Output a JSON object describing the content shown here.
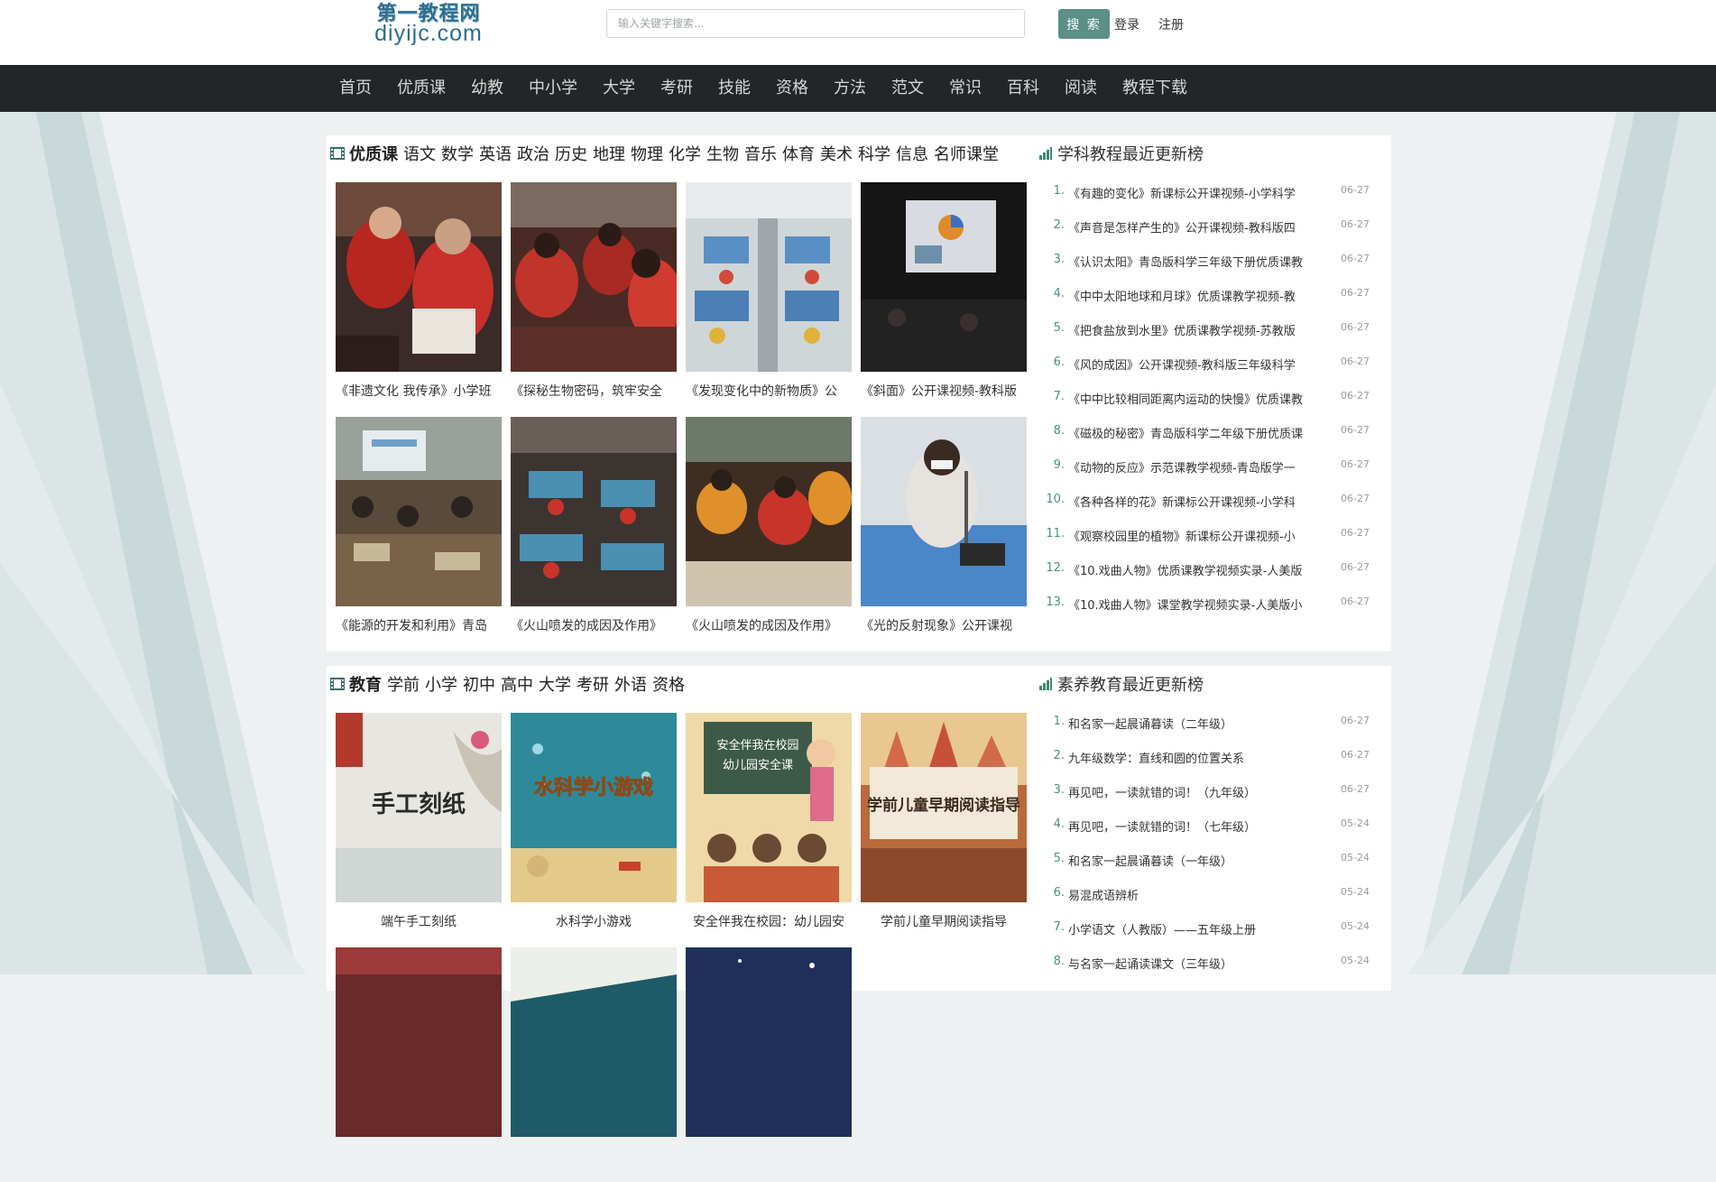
{
  "header": {
    "logo_cn": "第一教程网",
    "logo_en": "diyijc.com",
    "search_placeholder": "输入关键字搜索...",
    "search_button": "搜 索",
    "login": "登录",
    "register": "注册"
  },
  "nav": [
    "首页",
    "优质课",
    "幼教",
    "中小学",
    "大学",
    "考研",
    "技能",
    "资格",
    "方法",
    "范文",
    "常识",
    "百科",
    "阅读",
    "教程下载"
  ],
  "section1": {
    "title": "优质课",
    "tags": [
      "语文",
      "数学",
      "英语",
      "政治",
      "历史",
      "地理",
      "物理",
      "化学",
      "生物",
      "音乐",
      "体育",
      "美术",
      "科学",
      "信息",
      "名师课堂"
    ],
    "cards": [
      {
        "caption": "《非遗文化 我传承》小学班"
      },
      {
        "caption": "《探秘生物密码，筑牢安全"
      },
      {
        "caption": "《发现变化中的新物质》公"
      },
      {
        "caption": "《斜面》公开课视频-教科版"
      },
      {
        "caption": "《能源的开发和利用》青岛"
      },
      {
        "caption": "《火山喷发的成因及作用》"
      },
      {
        "caption": "《火山喷发的成因及作用》"
      },
      {
        "caption": "《光的反射现象》公开课视"
      }
    ],
    "rank_title": "学科教程最近更新榜",
    "rank": [
      {
        "num": "1.",
        "title": "《有趣的变化》新课标公开课视频-小学科学",
        "date": "06-27"
      },
      {
        "num": "2.",
        "title": "《声音是怎样产生的》公开课视频-教科版四",
        "date": "06-27"
      },
      {
        "num": "3.",
        "title": "《认识太阳》青岛版科学三年级下册优质课教",
        "date": "06-27"
      },
      {
        "num": "4.",
        "title": "《中中太阳地球和月球》优质课教学视频-教",
        "date": "06-27"
      },
      {
        "num": "5.",
        "title": "《把食盐放到水里》优质课教学视频-苏教版",
        "date": "06-27"
      },
      {
        "num": "6.",
        "title": "《风的成因》公开课视频-教科版三年级科学",
        "date": "06-27"
      },
      {
        "num": "7.",
        "title": "《中中比较相同距离内运动的快慢》优质课教",
        "date": "06-27"
      },
      {
        "num": "8.",
        "title": "《磁极的秘密》青岛版科学二年级下册优质课",
        "date": "06-27"
      },
      {
        "num": "9.",
        "title": "《动物的反应》示范课教学视频-青岛版学一",
        "date": "06-27"
      },
      {
        "num": "10.",
        "title": "《各种各样的花》新课标公开课视频-小学科",
        "date": "06-27"
      },
      {
        "num": "11.",
        "title": "《观察校园里的植物》新课标公开课视频-小",
        "date": "06-27"
      },
      {
        "num": "12.",
        "title": "《10.戏曲人物》优质课教学视频实录-人美版",
        "date": "06-27"
      },
      {
        "num": "13.",
        "title": "《10.戏曲人物》课堂教学视频实录-人美版小",
        "date": "06-27"
      }
    ]
  },
  "section2": {
    "title": "教育",
    "tags": [
      "学前",
      "小学",
      "初中",
      "高中",
      "大学",
      "考研",
      "外语",
      "资格"
    ],
    "cards": [
      {
        "caption": "端午手工刻纸",
        "art_text": "手工刻纸"
      },
      {
        "caption": "水科学小游戏",
        "art_text": "水科学小游戏"
      },
      {
        "caption": "安全伴我在校园：幼儿园安",
        "art_text_1": "安全伴我在校园",
        "art_text_2": "幼儿园安全课"
      },
      {
        "caption": "学前儿童早期阅读指导",
        "art_text": "学前儿童早期阅读指导"
      }
    ],
    "rank_title": "素养教育最近更新榜",
    "rank": [
      {
        "num": "1.",
        "title": "和名家一起晨诵暮读（二年级）",
        "date": "06-27"
      },
      {
        "num": "2.",
        "title": "九年级数学：直线和圆的位置关系",
        "date": "06-27"
      },
      {
        "num": "3.",
        "title": "再见吧，一读就错的词！（九年级）",
        "date": "06-27"
      },
      {
        "num": "4.",
        "title": "再见吧，一读就错的词！（七年级）",
        "date": "05-24"
      },
      {
        "num": "5.",
        "title": "和名家一起晨诵暮读（一年级）",
        "date": "05-24"
      },
      {
        "num": "6.",
        "title": "易混成语辨析",
        "date": "05-24"
      },
      {
        "num": "7.",
        "title": "小学语文（人教版）——五年级上册",
        "date": "05-24"
      },
      {
        "num": "8.",
        "title": "与名家一起诵读课文（三年级）",
        "date": "05-24"
      }
    ]
  },
  "colors": {
    "nav_bg": "#232628",
    "accent": "#5a9086",
    "rank_num": "#4f8d84",
    "page_bg": "#eef1f1"
  }
}
